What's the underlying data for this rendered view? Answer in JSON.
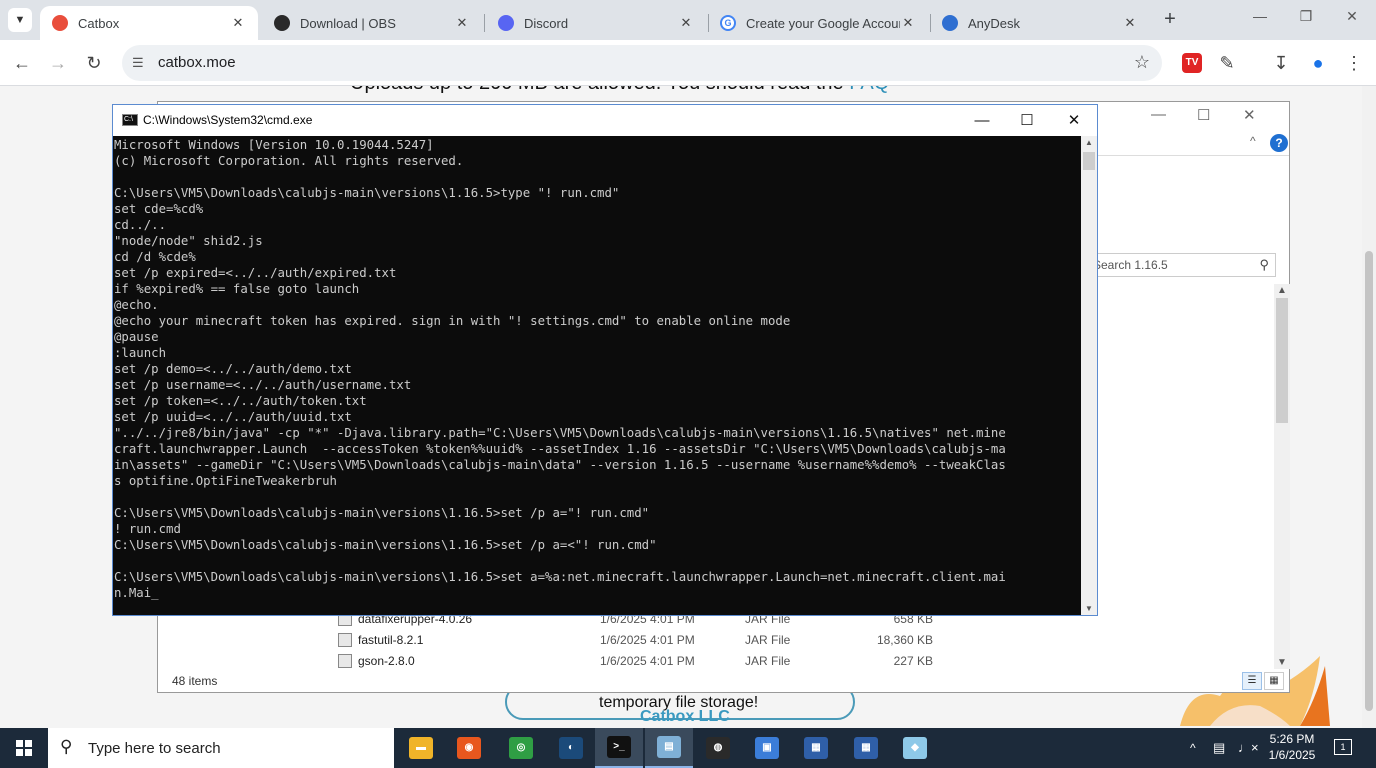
{
  "browser": {
    "tabs": [
      {
        "label": "Catbox",
        "favicon": "catbox-icon",
        "color": "#e94e3c",
        "active": true
      },
      {
        "label": "Download | OBS",
        "favicon": "obs-icon",
        "color": "#2a2a2a"
      },
      {
        "label": "Discord",
        "favicon": "discord-icon",
        "color": "#5865f2"
      },
      {
        "label": "Create your Google Account",
        "favicon": "google-icon",
        "color": "#4285f4"
      },
      {
        "label": "AnyDesk",
        "favicon": "anydesk-icon",
        "color": "#ef443b"
      }
    ],
    "url": "catbox.moe"
  },
  "webpage": {
    "heading": "Uploads up to 200 MB are allowed. You should read the",
    "heading_link": "FAQ",
    "pill_text": "temporary file storage!",
    "footer": "Catbox LLC"
  },
  "explorer": {
    "search_placeholder": "Search 1.16.5",
    "files": [
      {
        "name": "datafixerupper-4.0.26",
        "date": "1/6/2025 4:01 PM",
        "type": "JAR File",
        "size": "658 KB"
      },
      {
        "name": "fastutil-8.2.1",
        "date": "1/6/2025 4:01 PM",
        "type": "JAR File",
        "size": "18,360 KB"
      },
      {
        "name": "gson-2.8.0",
        "date": "1/6/2025 4:01 PM",
        "type": "JAR File",
        "size": "227 KB"
      }
    ],
    "item_count": "48 items"
  },
  "cmd": {
    "title": "C:\\Windows\\System32\\cmd.exe",
    "lines": [
      "Microsoft Windows [Version 10.0.19044.5247]",
      "(c) Microsoft Corporation. All rights reserved.",
      "",
      "C:\\Users\\VM5\\Downloads\\calubjs-main\\versions\\1.16.5>type \"! run.cmd\"",
      "set cde=%cd%",
      "cd../..",
      "\"node/node\" shid2.js",
      "cd /d %cde%",
      "set /p expired=<../../auth/expired.txt",
      "if %expired% == false goto launch",
      "@echo.",
      "@echo your minecraft token has expired. sign in with \"! settings.cmd\" to enable online mode",
      "@pause",
      ":launch",
      "set /p demo=<../../auth/demo.txt",
      "set /p username=<../../auth/username.txt",
      "set /p token=<../../auth/token.txt",
      "set /p uuid=<../../auth/uuid.txt",
      "\"../../jre8/bin/java\" -cp \"*\" -Djava.library.path=\"C:\\Users\\VM5\\Downloads\\calubjs-main\\versions\\1.16.5\\natives\" net.mine",
      "craft.launchwrapper.Launch  --accessToken %token%%uuid% --assetIndex 1.16 --assetsDir \"C:\\Users\\VM5\\Downloads\\calubjs-ma",
      "in\\assets\" --gameDir \"C:\\Users\\VM5\\Downloads\\calubjs-main\\data\" --version 1.16.5 --username %username%%demo% --tweakClas",
      "s optifine.OptiFineTweakerbruh",
      "",
      "C:\\Users\\VM5\\Downloads\\calubjs-main\\versions\\1.16.5>set /p a=\"! run.cmd\"",
      "! run.cmd",
      "C:\\Users\\VM5\\Downloads\\calubjs-main\\versions\\1.16.5>set /p a=<\"! run.cmd\"",
      "",
      "C:\\Users\\VM5\\Downloads\\calubjs-main\\versions\\1.16.5>set a=%a:net.minecraft.launchwrapper.Launch=net.minecraft.client.mai",
      "n.Mai"
    ]
  },
  "taskbar": {
    "search_placeholder": "Type here to search",
    "apps": [
      {
        "name": "file-explorer-icon",
        "color": "#f0b429",
        "glyph": "▬"
      },
      {
        "name": "firefox-icon",
        "color": "#e8571e",
        "glyph": "◉"
      },
      {
        "name": "chrome-icon",
        "color": "#2f9e44",
        "glyph": "◎"
      },
      {
        "name": "steam-icon",
        "color": "#1b4a7a",
        "glyph": "◐"
      },
      {
        "name": "cmd-icon",
        "color": "#111111",
        "glyph": ">_"
      },
      {
        "name": "notepad-icon",
        "color": "#7fb0d6",
        "glyph": "▤"
      },
      {
        "name": "obs-icon",
        "color": "#2a2a2a",
        "glyph": "◍"
      },
      {
        "name": "remote-desktop-icon",
        "color": "#3b7dd8",
        "glyph": "▣"
      },
      {
        "name": "window-app-icon",
        "color": "#2f5fa8",
        "glyph": "▦"
      },
      {
        "name": "window-app-icon-2",
        "color": "#2f5fa8",
        "glyph": "▦"
      },
      {
        "name": "paint-icon",
        "color": "#8ec9e8",
        "glyph": "◆"
      }
    ],
    "time": "5:26 PM",
    "date": "1/6/2025",
    "notifications": "1"
  }
}
